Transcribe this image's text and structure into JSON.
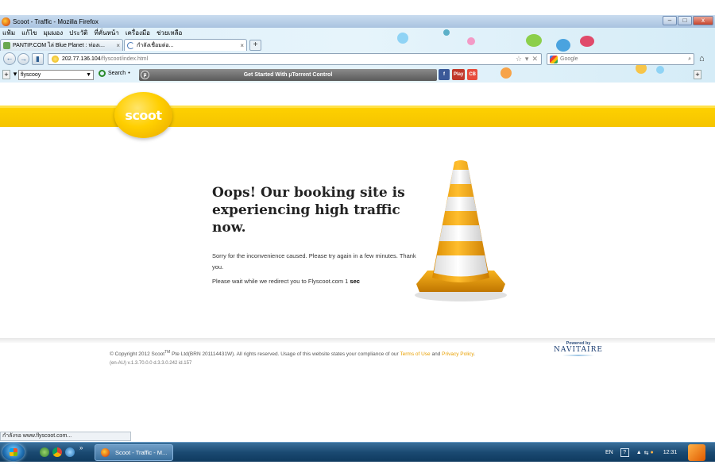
{
  "window": {
    "title": "Scoot - Traffic - Mozilla Firefox",
    "controls": [
      "–",
      "□",
      "x"
    ]
  },
  "menubar": [
    "แฟ้ม",
    "แก้ไข",
    "มุมมอง",
    "ประวัติ",
    "ที่คั่นหน้า",
    "เครื่องมือ",
    "ช่วยเหลือ"
  ],
  "tabs": [
    {
      "label": "PANTIP.COM ไล่ Blue Planet : ท่องเ...",
      "active": false
    },
    {
      "label": "กำลังเชื่อมต่อ...",
      "active": true
    }
  ],
  "tab_close": "×",
  "new_tab": "+",
  "navbar": {
    "back": "←",
    "forward": "→",
    "url_host": "202.77.136.104",
    "url_path": "/flyscoot/index.html",
    "search_placeholder": "Google",
    "home": "⌂"
  },
  "toolbar": {
    "add": "+",
    "select_value": "flyscooy",
    "search_label": "Search",
    "utorrent_label": "Get Started With µTorrent Control",
    "icon_labels": [
      "f",
      "Play",
      "CB"
    ]
  },
  "page": {
    "logo_text": "scoot",
    "headline": "Oops! Our booking site is experiencing high traffic now.",
    "message_line": "Sorry for the inconvenience caused. Please try again in a few minutes. Thank you.",
    "redirect_prefix": "Please wait while we redirect you to Flyscoot.com 1",
    "redirect_unit": "sec",
    "copyright_prefix": "© Copyright 2012 Scoot",
    "copyright_tm": "TM",
    "copyright_mid": " Pte Ltd(BRN 201114431W). All rights reserved. Usage of this website states your compliance of our ",
    "terms_link": "Terms of Use",
    "and": " and ",
    "privacy_link": "Privacy Policy",
    "period": ".",
    "version": "(en-AU)  v.1.3.70.0.0 d.3.3.0.242 id.157",
    "powered_by": "Powered by",
    "navitaire": "NAVITAIRE"
  },
  "statusbar": "กำลังรอ www.flyscoot.com...",
  "taskbar": {
    "task_label": "Scoot - Traffic - M...",
    "lang": "EN",
    "help": "?",
    "time": "12:31"
  },
  "colors": {
    "brand_yellow": "#ffd200",
    "link_orange": "#e9a000",
    "cone_orange": "#f0a500"
  }
}
